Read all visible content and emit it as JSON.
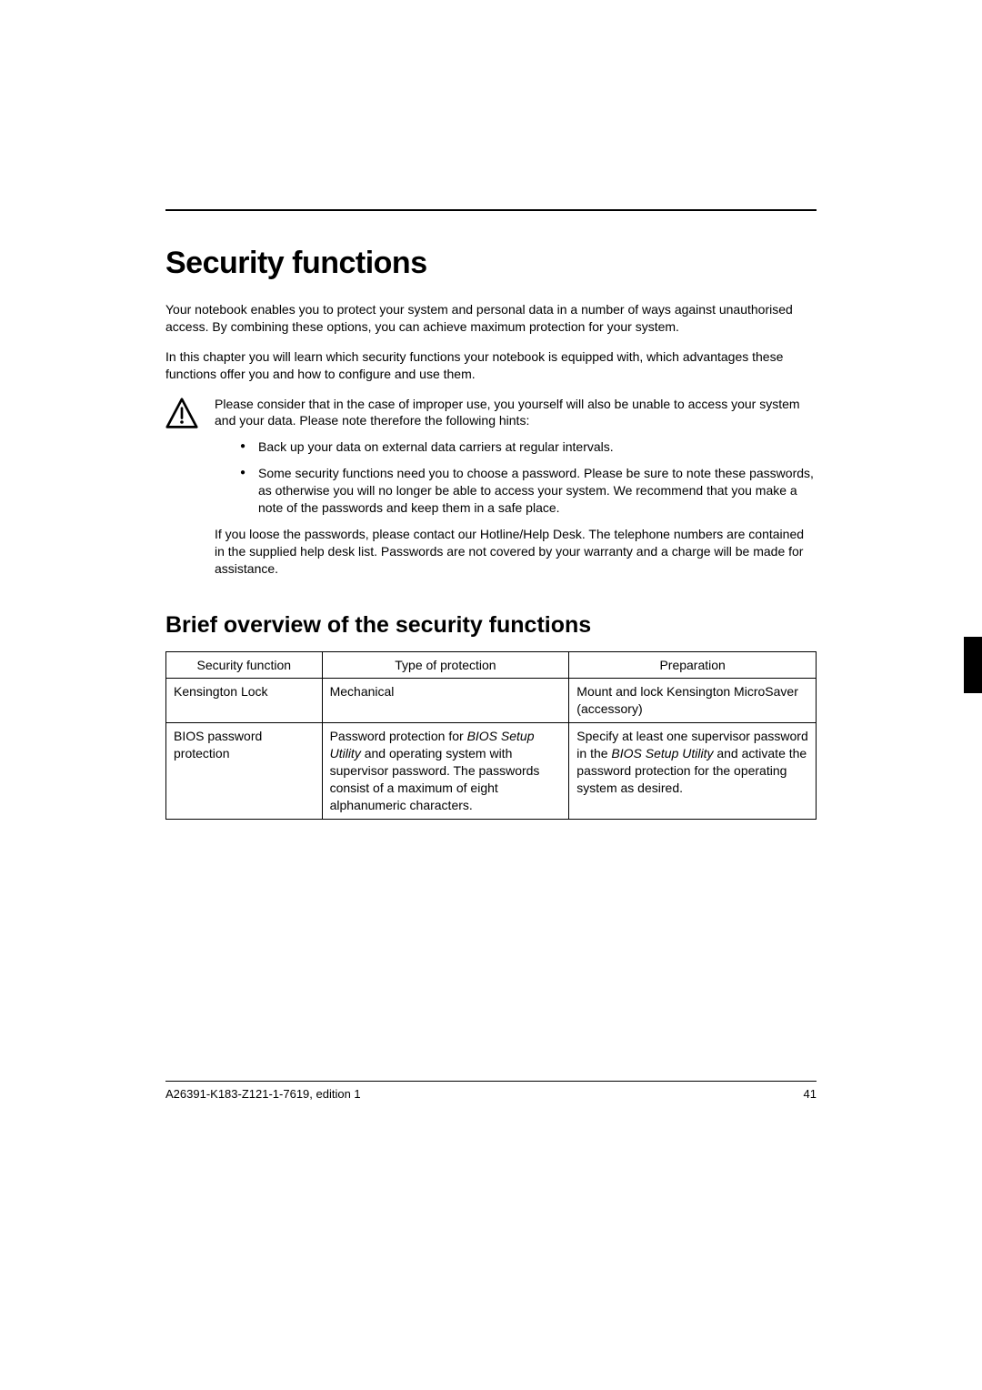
{
  "heading": "Security functions",
  "intro1": "Your notebook enables you to protect your system and personal data in a number of ways against unauthorised access. By combining these options, you can achieve maximum protection for your system.",
  "intro2": "In this chapter you will learn which security functions your notebook is equipped with, which advantages these functions offer you and how to configure and use them.",
  "warning": {
    "para1": "Please consider that in the case of improper use, you yourself will also be unable to access your system and your data. Please note therefore the following hints:",
    "bullets": [
      "Back up your data on external data carriers at regular intervals.",
      "Some security functions need you to choose a password. Please be sure to note these passwords, as otherwise you will no longer be able to access your system. We recommend that you make a note of the passwords and keep them in a safe place."
    ],
    "para2": "If you loose the passwords, please contact our Hotline/Help Desk. The telephone numbers are contained in the supplied help desk list. Passwords are not covered by your warranty and a charge will be made for assistance."
  },
  "subheading": "Brief overview of the security functions",
  "table": {
    "headers": [
      "Security function",
      "Type of protection",
      "Preparation"
    ],
    "rows": [
      {
        "c1": "Kensington Lock",
        "c2": [
          {
            "t": "Mechanical"
          }
        ],
        "c3": [
          {
            "t": "Mount and lock Kensington MicroSaver (accessory)"
          }
        ]
      },
      {
        "c1": "BIOS password protection",
        "c2": [
          {
            "t": "Password protection for "
          },
          {
            "t": "BIOS Setup Utility",
            "i": true
          },
          {
            "t": " and operating system with supervisor password. The passwords consist of a maximum of eight alphanumeric characters."
          }
        ],
        "c3": [
          {
            "t": "Specify at least one supervisor password in the "
          },
          {
            "t": "BIOS Setup Utility",
            "i": true
          },
          {
            "t": " and activate the password protection for the operating system as desired."
          }
        ]
      }
    ]
  },
  "footer": {
    "left": "A26391-K183-Z121-1-7619, edition 1",
    "right": "41"
  }
}
